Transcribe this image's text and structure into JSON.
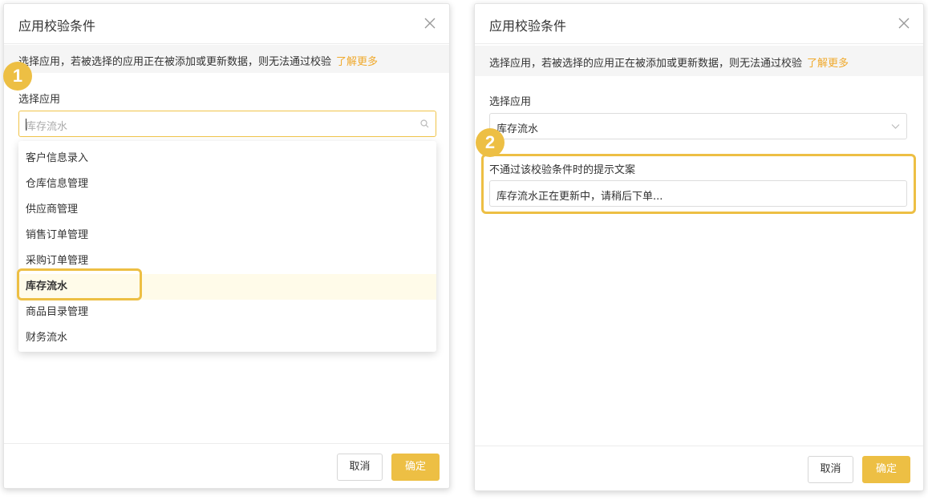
{
  "left_dialog": {
    "title": "应用校验条件",
    "notice": "选择应用，若被选择的应用正在被添加或更新数据，则无法通过校验",
    "notice_link": "了解更多",
    "field_label": "选择应用",
    "search_value": "库存流水",
    "dropdown_items": [
      "客户信息录入",
      "仓库信息管理",
      "供应商管理",
      "销售订单管理",
      "采购订单管理",
      "库存流水",
      "商品目录管理",
      "财务流水"
    ],
    "selected_item": "库存流水",
    "cancel_label": "取消",
    "ok_label": "确定"
  },
  "right_dialog": {
    "title": "应用校验条件",
    "notice": "选择应用，若被选择的应用正在被添加或更新数据，则无法通过校验",
    "notice_link": "了解更多",
    "field_label": "选择应用",
    "select_value": "库存流水",
    "message_label": "不通过该校验条件时的提示文案",
    "message_value": "库存流水正在更新中，请稍后下单...",
    "cancel_label": "取消",
    "ok_label": "确定"
  },
  "badges": {
    "step1": "1",
    "step2": "2"
  },
  "colors": {
    "accent": "#edbf44",
    "link": "#f0a92c",
    "selected_bg": "#fffbe9"
  },
  "icons": {
    "close": "close-icon",
    "search": "search-icon",
    "chevron": "chevron-down-icon"
  }
}
